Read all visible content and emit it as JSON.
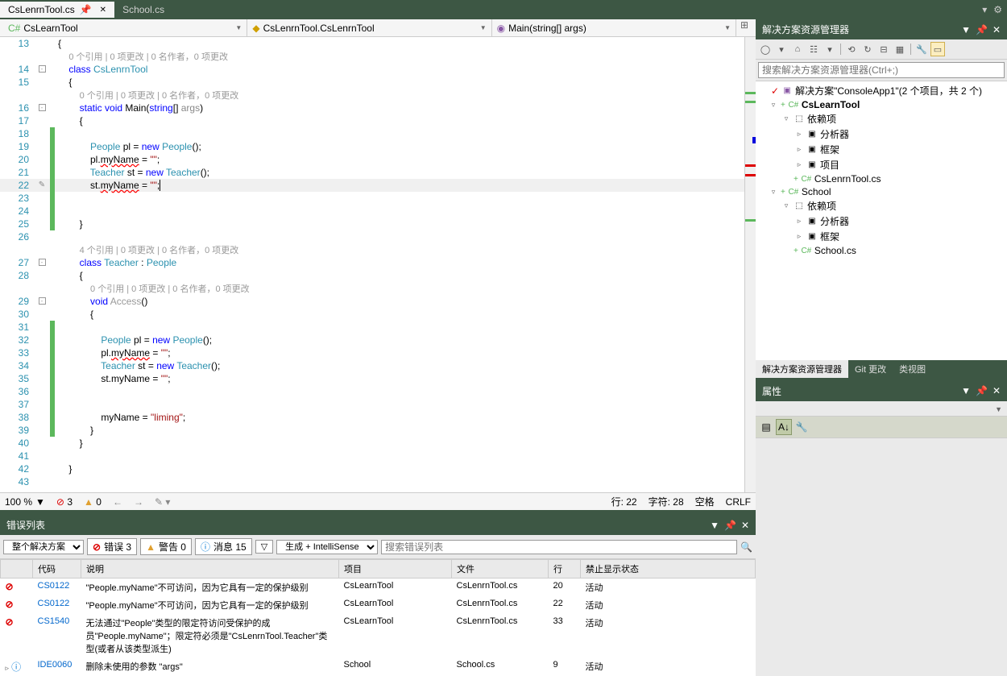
{
  "tabs": [
    {
      "label": "CsLenrnTool.cs",
      "active": true
    },
    {
      "label": "School.cs",
      "active": false
    }
  ],
  "nav": {
    "project": "CsLearnTool",
    "class": "CsLenrnTool.CsLenrnTool",
    "method": "Main(string[] args)"
  },
  "code_lines": [
    {
      "n": "13",
      "fold": "",
      "bar": "",
      "html": "{"
    },
    {
      "n": "",
      "fold": "",
      "bar": "",
      "html": "    <span class='codelens'>0 个引用 | 0 项更改 | 0 名作者，0 项更改</span>"
    },
    {
      "n": "14",
      "fold": "box",
      "bar": "",
      "html": "    <span class='kw'>class</span> <span class='type'>CsLenrnTool</span>"
    },
    {
      "n": "15",
      "fold": "",
      "bar": "",
      "html": "    {"
    },
    {
      "n": "",
      "fold": "",
      "bar": "",
      "html": "        <span class='codelens'>0 个引用 | 0 项更改 | 0 名作者，0 项更改</span>"
    },
    {
      "n": "16",
      "fold": "box",
      "bar": "",
      "html": "        <span class='kw'>static</span> <span class='kw'>void</span> Main(<span class='kw'>string</span>[] <span style='color:#888'>args</span>)"
    },
    {
      "n": "17",
      "fold": "",
      "bar": "",
      "html": "        {"
    },
    {
      "n": "18",
      "fold": "",
      "bar": "green",
      "html": ""
    },
    {
      "n": "19",
      "fold": "",
      "bar": "green",
      "html": "            <span class='type'>People</span> pl = <span class='kw'>new</span> <span class='type'>People</span>();"
    },
    {
      "n": "20",
      "fold": "",
      "bar": "green",
      "html": "            pl.<span class='err'>myName</span> = <span class='str'>\"\"</span>;"
    },
    {
      "n": "21",
      "fold": "",
      "bar": "green",
      "html": "            <span class='type'>Teacher</span> st = <span class='kw'>new</span> <span class='type'>Teacher</span>();"
    },
    {
      "n": "22",
      "fold": "",
      "bar": "green",
      "html": "            st.<span class='err'>myName</span> = <span class='str'>\"\"</span>;<span class='cursor'></span>",
      "current": true,
      "pencil": true
    },
    {
      "n": "23",
      "fold": "",
      "bar": "green",
      "html": ""
    },
    {
      "n": "24",
      "fold": "",
      "bar": "green",
      "html": ""
    },
    {
      "n": "25",
      "fold": "",
      "bar": "green",
      "html": "        }"
    },
    {
      "n": "26",
      "fold": "",
      "bar": "",
      "html": ""
    },
    {
      "n": "",
      "fold": "",
      "bar": "",
      "html": "        <span class='codelens'>4 个引用 | 0 项更改 | 0 名作者，0 项更改</span>"
    },
    {
      "n": "27",
      "fold": "box",
      "bar": "",
      "html": "        <span class='kw'>class</span> <span class='type'>Teacher</span> : <span class='type'>People</span>"
    },
    {
      "n": "28",
      "fold": "",
      "bar": "",
      "html": "        {"
    },
    {
      "n": "",
      "fold": "",
      "bar": "",
      "html": "            <span class='codelens'>0 个引用 | 0 项更改 | 0 名作者，0 项更改</span>"
    },
    {
      "n": "29",
      "fold": "box",
      "bar": "",
      "html": "            <span class='kw'>void</span> <span style='color:#999'>Access</span>()"
    },
    {
      "n": "30",
      "fold": "",
      "bar": "",
      "html": "            {"
    },
    {
      "n": "31",
      "fold": "",
      "bar": "green",
      "html": ""
    },
    {
      "n": "32",
      "fold": "",
      "bar": "green",
      "html": "                <span class='type'>People</span> pl = <span class='kw'>new</span> <span class='type'>People</span>();"
    },
    {
      "n": "33",
      "fold": "",
      "bar": "green",
      "html": "                pl.<span class='err'>myName</span> = <span class='str'>\"\"</span>;"
    },
    {
      "n": "34",
      "fold": "",
      "bar": "green",
      "html": "                <span class='type'>Teacher</span> st = <span class='kw'>new</span> <span class='type'>Teacher</span>();"
    },
    {
      "n": "35",
      "fold": "",
      "bar": "green",
      "html": "                st.myName = <span class='str'>\"\"</span>;"
    },
    {
      "n": "36",
      "fold": "",
      "bar": "green",
      "html": ""
    },
    {
      "n": "37",
      "fold": "",
      "bar": "green",
      "html": ""
    },
    {
      "n": "38",
      "fold": "",
      "bar": "green",
      "html": "                myName = <span class='str'>\"liming\"</span>;"
    },
    {
      "n": "39",
      "fold": "",
      "bar": "green",
      "html": "            }"
    },
    {
      "n": "40",
      "fold": "",
      "bar": "",
      "html": "        }"
    },
    {
      "n": "41",
      "fold": "",
      "bar": "",
      "html": ""
    },
    {
      "n": "42",
      "fold": "",
      "bar": "",
      "html": "    }"
    },
    {
      "n": "43",
      "fold": "",
      "bar": "",
      "html": ""
    }
  ],
  "editor_status": {
    "zoom": "100 %",
    "errors": "3",
    "warnings": "0",
    "line": "行: 22",
    "col": "字符: 28",
    "ins": "空格",
    "eol": "CRLF"
  },
  "error_panel": {
    "title": "错误列表",
    "scope": "整个解决方案",
    "err_btn": "错误 3",
    "warn_btn": "警告 0",
    "msg_btn": "消息 15",
    "build": "生成 + IntelliSense",
    "search_placeholder": "搜索错误列表",
    "columns": [
      "",
      "代码",
      "说明",
      "项目",
      "文件",
      "行",
      "禁止显示状态"
    ],
    "rows": [
      {
        "icon": "err",
        "code": "CS0122",
        "desc": "\"People.myName\"不可访问，因为它具有一定的保护级别",
        "proj": "CsLearnTool",
        "file": "CsLenrnTool.cs",
        "line": "20",
        "sup": "活动"
      },
      {
        "icon": "err",
        "code": "CS0122",
        "desc": "\"People.myName\"不可访问，因为它具有一定的保护级别",
        "proj": "CsLearnTool",
        "file": "CsLenrnTool.cs",
        "line": "22",
        "sup": "活动"
      },
      {
        "icon": "err",
        "code": "CS1540",
        "desc": "无法通过\"People\"类型的限定符访问受保护的成员\"People.myName\"；限定符必须是\"CsLenrnTool.Teacher\"类型(或者从该类型派生)",
        "proj": "CsLearnTool",
        "file": "CsLenrnTool.cs",
        "line": "33",
        "sup": "活动"
      },
      {
        "icon": "info",
        "exp": true,
        "code": "IDE0060",
        "desc": "删除未使用的参数 \"args\"",
        "proj": "School",
        "file": "School.cs",
        "line": "9",
        "sup": "活动"
      }
    ]
  },
  "solution": {
    "title": "解决方案资源管理器",
    "search_placeholder": "搜索解决方案资源管理器(Ctrl+;)",
    "root": "解决方案\"ConsoleApp1\"(2 个项目，共 2 个)",
    "tree": [
      {
        "ind": 1,
        "exp": "▿",
        "ico": "proj",
        "label": "CsLearnTool",
        "bold": true,
        "pre": "+"
      },
      {
        "ind": 2,
        "exp": "▿",
        "ico": "dep",
        "label": "依赖项"
      },
      {
        "ind": 3,
        "exp": "▹",
        "ico": "fr",
        "label": "分析器"
      },
      {
        "ind": 3,
        "exp": "▹",
        "ico": "fr",
        "label": "框架"
      },
      {
        "ind": 3,
        "exp": "▹",
        "ico": "fr",
        "label": "项目"
      },
      {
        "ind": 2,
        "exp": "",
        "ico": "cs",
        "label": "CsLenrnTool.cs",
        "pre": "+"
      },
      {
        "ind": 1,
        "exp": "▿",
        "ico": "proj",
        "label": "School",
        "pre": "+"
      },
      {
        "ind": 2,
        "exp": "▿",
        "ico": "dep",
        "label": "依赖项"
      },
      {
        "ind": 3,
        "exp": "▹",
        "ico": "fr",
        "label": "分析器"
      },
      {
        "ind": 3,
        "exp": "▹",
        "ico": "fr",
        "label": "框架"
      },
      {
        "ind": 2,
        "exp": "",
        "ico": "cs",
        "label": "School.cs",
        "pre": "+"
      }
    ],
    "tabs": [
      "解决方案资源管理器",
      "Git 更改",
      "类视图"
    ]
  },
  "properties": {
    "title": "属性"
  }
}
